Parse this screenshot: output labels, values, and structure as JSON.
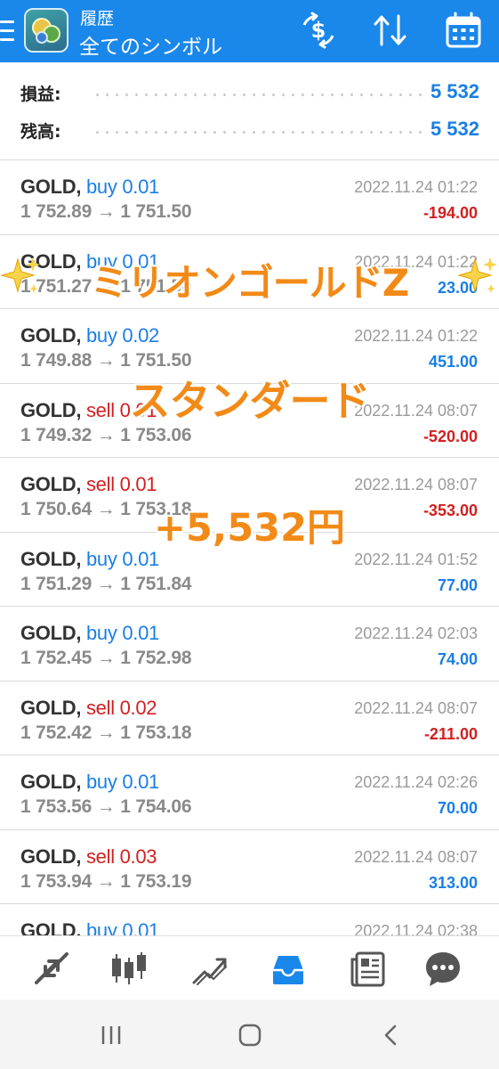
{
  "header": {
    "subtitle": "履歴",
    "title": "全てのシンボル",
    "icons": [
      "menu-icon",
      "metatrader-logo",
      "deposit-swap-icon",
      "sort-icon",
      "calendar-icon"
    ]
  },
  "summary": {
    "rows": [
      {
        "label": "損益:",
        "value": "5 532"
      },
      {
        "label": "残高:",
        "value": "5 532"
      }
    ]
  },
  "trades": [
    {
      "symbol": "GOLD,",
      "side": "buy",
      "lots": "0.01",
      "prices": "1 752.89 → 1 751.50",
      "time": "2022.11.24 01:22",
      "profit": "-194.00"
    },
    {
      "symbol": "GOLD,",
      "side": "buy",
      "lots": "0.01",
      "prices": "1 751.27 → 1 751.50",
      "time": "2022.11.24 01:22",
      "profit": "23.00"
    },
    {
      "symbol": "GOLD,",
      "side": "buy",
      "lots": "0.02",
      "prices": "1 749.88 → 1 751.50",
      "time": "2022.11.24 01:22",
      "profit": "451.00"
    },
    {
      "symbol": "GOLD,",
      "side": "sell",
      "lots": "0.01",
      "prices": "1 749.32 → 1 753.06",
      "time": "2022.11.24 08:07",
      "profit": "-520.00"
    },
    {
      "symbol": "GOLD,",
      "side": "sell",
      "lots": "0.01",
      "prices": "1 750.64 → 1 753.18",
      "time": "2022.11.24 08:07",
      "profit": "-353.00"
    },
    {
      "symbol": "GOLD,",
      "side": "buy",
      "lots": "0.01",
      "prices": "1 751.29 → 1 751.84",
      "time": "2022.11.24 01:52",
      "profit": "77.00"
    },
    {
      "symbol": "GOLD,",
      "side": "buy",
      "lots": "0.01",
      "prices": "1 752.45 → 1 752.98",
      "time": "2022.11.24 02:03",
      "profit": "74.00"
    },
    {
      "symbol": "GOLD,",
      "side": "sell",
      "lots": "0.02",
      "prices": "1 752.42 → 1 753.18",
      "time": "2022.11.24 08:07",
      "profit": "-211.00"
    },
    {
      "symbol": "GOLD,",
      "side": "buy",
      "lots": "0.01",
      "prices": "1 753.56 → 1 754.06",
      "time": "2022.11.24 02:26",
      "profit": "70.00"
    },
    {
      "symbol": "GOLD,",
      "side": "sell",
      "lots": "0.03",
      "prices": "1 753.94 → 1 753.19",
      "time": "2022.11.24 08:07",
      "profit": "313.00"
    },
    {
      "symbol": "GOLD,",
      "side": "buy",
      "lots": "0.01",
      "prices": "",
      "time": "2022.11.24 02:38",
      "profit": ""
    }
  ],
  "overlay": {
    "line1": "ミリオンゴールドZ",
    "line2": "スタンダード",
    "line3": "+5,532円"
  },
  "tabbar": {
    "items": [
      "quotes-icon",
      "chart-icon",
      "trade-icon",
      "history-icon",
      "news-icon",
      "chat-icon"
    ],
    "active": "history-icon",
    "active_color": "#1a87ea"
  },
  "navbar": {
    "items": [
      "recent-apps-icon",
      "home-icon",
      "back-icon"
    ]
  },
  "colors": {
    "header_bg": "#1a87ea",
    "positive": "#1a7ee6",
    "negative": "#d31f1f",
    "overlay_text": "#f28a18"
  }
}
